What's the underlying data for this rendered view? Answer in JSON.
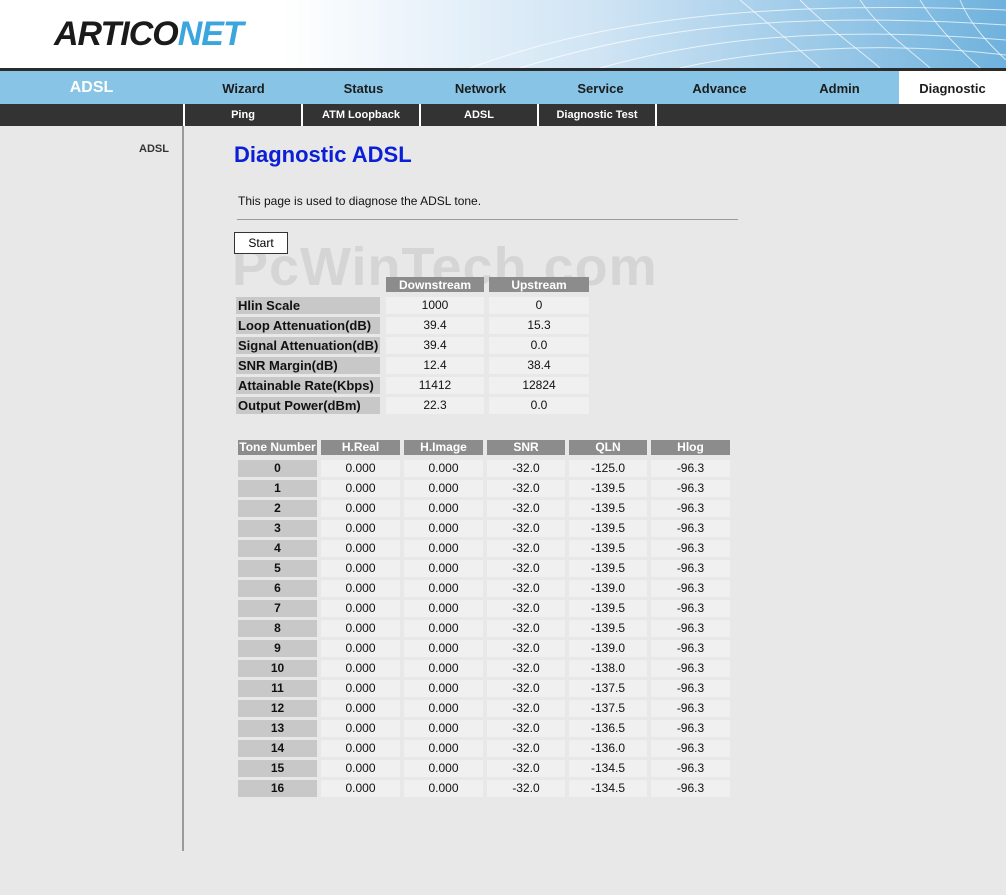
{
  "brand": {
    "logo_part1": "ARTICO",
    "logo_part2": "NET"
  },
  "mainnav": {
    "brand_label": "ADSL",
    "tabs": [
      {
        "label": "Wizard"
      },
      {
        "label": "Status"
      },
      {
        "label": "Network"
      },
      {
        "label": "Service"
      },
      {
        "label": "Advance"
      },
      {
        "label": "Admin"
      },
      {
        "label": "Diagnostic",
        "active": true
      }
    ]
  },
  "subnav": {
    "tabs": [
      {
        "label": "Ping"
      },
      {
        "label": "ATM Loopback"
      },
      {
        "label": "ADSL"
      },
      {
        "label": "Diagnostic Test"
      }
    ]
  },
  "sidebar": {
    "items": [
      {
        "label": "ADSL"
      }
    ]
  },
  "page": {
    "title": "Diagnostic ADSL",
    "description": "This page is used to diagnose the ADSL tone.",
    "start_label": "Start",
    "watermark": "PcWinTech.com"
  },
  "stats": {
    "headers": [
      "Downstream",
      "Upstream"
    ],
    "rows": [
      {
        "label": "Hlin Scale",
        "down": "1000",
        "up": "0"
      },
      {
        "label": "Loop Attenuation(dB)",
        "down": "39.4",
        "up": "15.3"
      },
      {
        "label": "Signal Attenuation(dB)",
        "down": "39.4",
        "up": "0.0"
      },
      {
        "label": "SNR Margin(dB)",
        "down": "12.4",
        "up": "38.4"
      },
      {
        "label": "Attainable Rate(Kbps)",
        "down": "11412",
        "up": "12824"
      },
      {
        "label": "Output Power(dBm)",
        "down": "22.3",
        "up": "0.0"
      }
    ]
  },
  "tones": {
    "headers": [
      "Tone Number",
      "H.Real",
      "H.Image",
      "SNR",
      "QLN",
      "Hlog"
    ],
    "rows": [
      [
        "0",
        "0.000",
        "0.000",
        "-32.0",
        "-125.0",
        "-96.3"
      ],
      [
        "1",
        "0.000",
        "0.000",
        "-32.0",
        "-139.5",
        "-96.3"
      ],
      [
        "2",
        "0.000",
        "0.000",
        "-32.0",
        "-139.5",
        "-96.3"
      ],
      [
        "3",
        "0.000",
        "0.000",
        "-32.0",
        "-139.5",
        "-96.3"
      ],
      [
        "4",
        "0.000",
        "0.000",
        "-32.0",
        "-139.5",
        "-96.3"
      ],
      [
        "5",
        "0.000",
        "0.000",
        "-32.0",
        "-139.5",
        "-96.3"
      ],
      [
        "6",
        "0.000",
        "0.000",
        "-32.0",
        "-139.0",
        "-96.3"
      ],
      [
        "7",
        "0.000",
        "0.000",
        "-32.0",
        "-139.5",
        "-96.3"
      ],
      [
        "8",
        "0.000",
        "0.000",
        "-32.0",
        "-139.5",
        "-96.3"
      ],
      [
        "9",
        "0.000",
        "0.000",
        "-32.0",
        "-139.0",
        "-96.3"
      ],
      [
        "10",
        "0.000",
        "0.000",
        "-32.0",
        "-138.0",
        "-96.3"
      ],
      [
        "11",
        "0.000",
        "0.000",
        "-32.0",
        "-137.5",
        "-96.3"
      ],
      [
        "12",
        "0.000",
        "0.000",
        "-32.0",
        "-137.5",
        "-96.3"
      ],
      [
        "13",
        "0.000",
        "0.000",
        "-32.0",
        "-136.5",
        "-96.3"
      ],
      [
        "14",
        "0.000",
        "0.000",
        "-32.0",
        "-136.0",
        "-96.3"
      ],
      [
        "15",
        "0.000",
        "0.000",
        "-32.0",
        "-134.5",
        "-96.3"
      ],
      [
        "16",
        "0.000",
        "0.000",
        "-32.0",
        "-134.5",
        "-96.3"
      ]
    ]
  },
  "colors": {
    "title": "#0a1fd6",
    "nav_bg": "#87c4e6",
    "subnav_bg": "#333333",
    "logo_accent": "#3aa6dd"
  }
}
